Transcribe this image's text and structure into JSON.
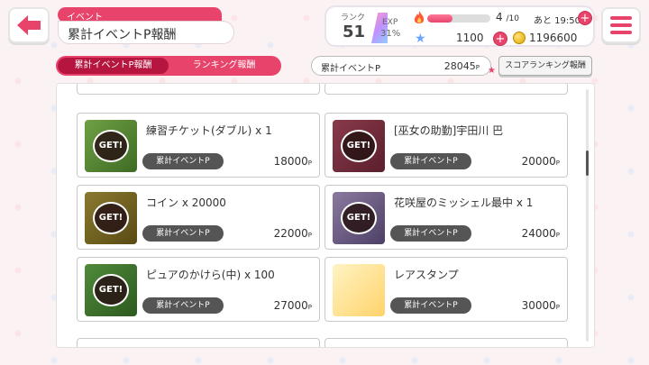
{
  "header": {
    "section_tag": "イベント",
    "title": "累計イベントP報酬"
  },
  "status": {
    "rank_label": "ランク",
    "rank": "51",
    "exp_label": "EXP",
    "exp_percent": "31%",
    "stamina_current": "4",
    "stamina_max": "/10",
    "stamina_fraction": 0.4,
    "recovery": "あと 19:50",
    "stars": "1100",
    "coins": "1196600"
  },
  "tabs": [
    {
      "label": "累計イベントP報酬",
      "active": true
    },
    {
      "label": "ランキング報酬",
      "active": false
    }
  ],
  "points": {
    "label": "累計イベントP",
    "value": "28045",
    "unit": "P"
  },
  "score_rank_button": "スコアランキング報酬",
  "rewards": [
    {
      "name": "練習チケット(ダブル) x 1",
      "pill": "累計イベントP",
      "points": "18000",
      "unit": "P",
      "badge": "GET!",
      "thumb": "ticket-icon"
    },
    {
      "name": "[巫女の助勤]宇田川 巴",
      "pill": "累計イベントP",
      "points": "20000",
      "unit": "P",
      "badge": "GET!",
      "thumb": "character-card-icon"
    },
    {
      "name": "コイン x 20000",
      "pill": "累計イベントP",
      "points": "22000",
      "unit": "P",
      "badge": "GET!",
      "thumb": "coin-icon"
    },
    {
      "name": "花咲屋のミッシェル最中 x 1",
      "pill": "累計イベントP",
      "points": "24000",
      "unit": "P",
      "badge": "GET!",
      "thumb": "sweets-icon"
    },
    {
      "name": "ピュアのかけら(中) x 100",
      "pill": "累計イベントP",
      "points": "27000",
      "unit": "P",
      "badge": "GET!",
      "thumb": "shard-icon"
    },
    {
      "name": "レアスタンプ",
      "pill": "累計イベントP",
      "points": "30000",
      "unit": "P",
      "badge": "",
      "thumb": "stamp-icon"
    }
  ]
}
